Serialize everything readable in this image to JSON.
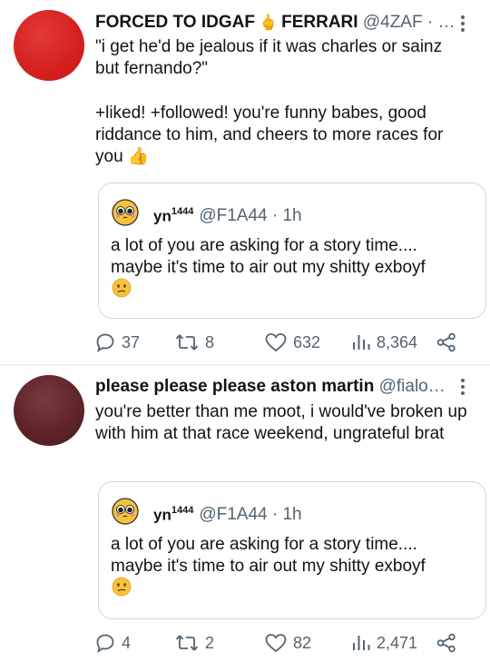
{
  "tweets": [
    {
      "author_name": "FORCED TO IDGAF",
      "author_emoji": "🖕",
      "author_name2": "FERRARI",
      "handle": "@4ZAF",
      "ellipsis": "· …",
      "text_line1": "\"i get he'd be jealous if it was charles or sainz but fernando?\"",
      "text_line2": "+liked! +followed! you're funny babes, good riddance to him, and cheers to more races for you",
      "text_emoji": "👍",
      "quote": {
        "name": "yn",
        "sup": "1444",
        "handle": "@F1A44 · 1h",
        "text": "a lot of you are asking for a story time.... maybe it's time to air out my shitty exboyf",
        "emoji": "confused-face"
      },
      "stats": {
        "replies": "37",
        "retweets": "8",
        "likes": "632",
        "views": "8,364"
      }
    },
    {
      "author_name": "please please please aston martin",
      "handle": "@fialo…",
      "text_line1": "you're better than me moot, i would've broken up with him at that race weekend, ungrateful brat",
      "quote": {
        "name": "yn",
        "sup": "1444",
        "handle": "@F1A44 · 1h",
        "text": "a lot of you are asking for a story time.... maybe it's time to air out my shitty exboyf",
        "emoji": "confused-face"
      },
      "stats": {
        "replies": "4",
        "retweets": "2",
        "likes": "82",
        "views": "2,471"
      }
    }
  ],
  "colors": {
    "text": "#0f1419",
    "secondary": "#536471",
    "border": "#cfd9de",
    "avatar1": "#d4201f",
    "avatar2": "#5c2328"
  }
}
